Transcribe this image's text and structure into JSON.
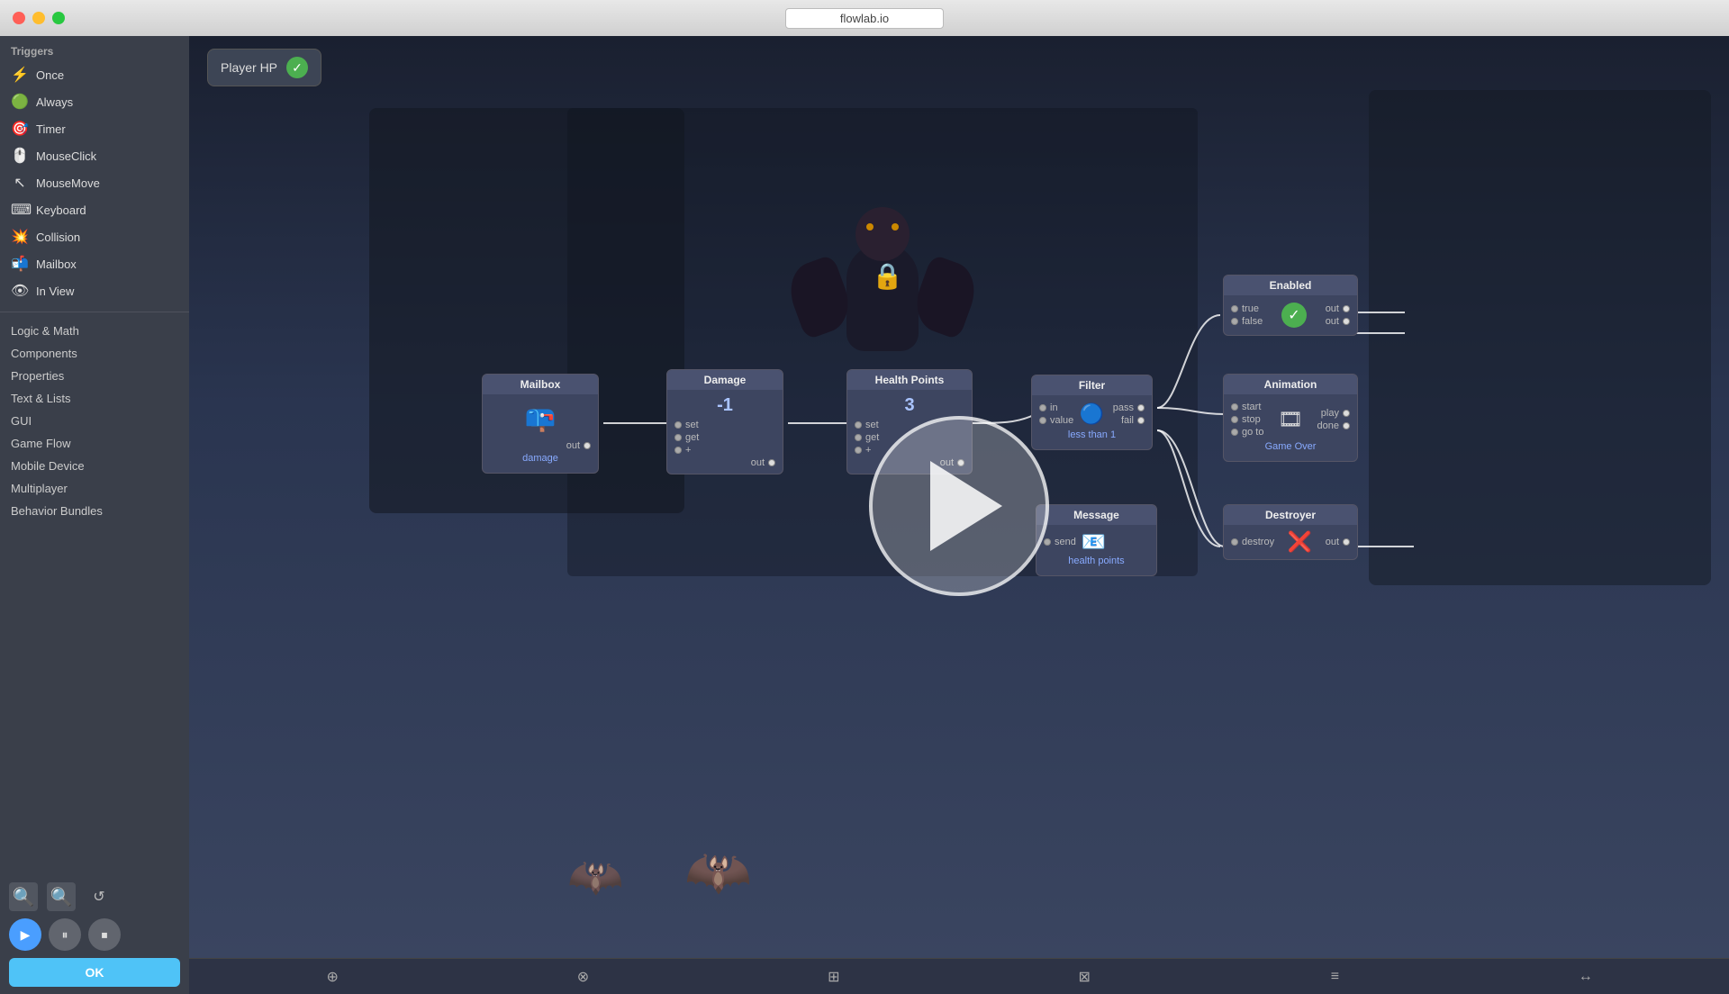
{
  "window": {
    "title": "flowlab.io"
  },
  "titlebar": {
    "close": "close",
    "minimize": "minimize",
    "maximize": "maximize"
  },
  "sidebar": {
    "triggers_label": "Triggers",
    "triggers": [
      {
        "id": "once",
        "label": "Once",
        "icon": "⚡"
      },
      {
        "id": "always",
        "label": "Always",
        "icon": "🟢"
      },
      {
        "id": "timer",
        "label": "Timer",
        "icon": "🎯"
      },
      {
        "id": "mouseclick",
        "label": "MouseClick",
        "icon": "🖱️"
      },
      {
        "id": "mousemove",
        "label": "MouseMove",
        "icon": "↖"
      },
      {
        "id": "keyboard",
        "label": "Keyboard",
        "icon": "⌨"
      },
      {
        "id": "collision",
        "label": "Collision",
        "icon": "💥"
      },
      {
        "id": "mailbox",
        "label": "Mailbox",
        "icon": "📬"
      },
      {
        "id": "inview",
        "label": "In View",
        "icon": "👁"
      }
    ],
    "categories": [
      "Logic & Math",
      "Components",
      "Properties",
      "Text & Lists",
      "GUI",
      "Game Flow",
      "Mobile Device",
      "Multiplayer",
      "Behavior Bundles"
    ]
  },
  "header": {
    "player_hp": "Player HP",
    "check_icon": "✓"
  },
  "nodes": {
    "mailbox": {
      "title": "Mailbox",
      "label": "damage",
      "ports_out": [
        "out"
      ]
    },
    "damage": {
      "title": "Damage",
      "value": "-1",
      "ports_in": [
        "set",
        "get",
        "+"
      ],
      "ports_out": [
        "out"
      ]
    },
    "health_points": {
      "title": "Health Points",
      "value": "3",
      "ports_in": [
        "set",
        "get",
        "+"
      ],
      "ports_out": [
        "out"
      ]
    },
    "filter": {
      "title": "Filter",
      "sublabel": "less than 1",
      "ports_in": [
        "in",
        "value"
      ],
      "ports_out": [
        "pass",
        "fail"
      ]
    },
    "enabled": {
      "title": "Enabled",
      "ports_out": [
        "out (true)",
        "out (false)"
      ],
      "labels": [
        "true",
        "false"
      ]
    },
    "animation": {
      "title": "Animation",
      "sublabel": "Game Over",
      "ports_in": [
        "start",
        "stop",
        "go to"
      ],
      "ports_out": [
        "play",
        "done"
      ]
    },
    "message": {
      "title": "Message",
      "sublabel": "health points",
      "ports_in": [
        "send"
      ]
    },
    "destroyer": {
      "title": "Destroyer",
      "ports_in": [
        "destroy"
      ],
      "ports_out": [
        "out"
      ]
    }
  },
  "play_overlay": {
    "visible": true
  },
  "bottom_toolbar": {
    "icons": [
      "⊕",
      "⊗",
      "⊞",
      "⊠",
      "≡",
      "↔"
    ]
  },
  "controls": {
    "zoom_in": "+",
    "zoom_out": "−",
    "reset": "↺",
    "play": "▶",
    "pause": "⏸",
    "stop": "⏹",
    "ok": "OK"
  }
}
